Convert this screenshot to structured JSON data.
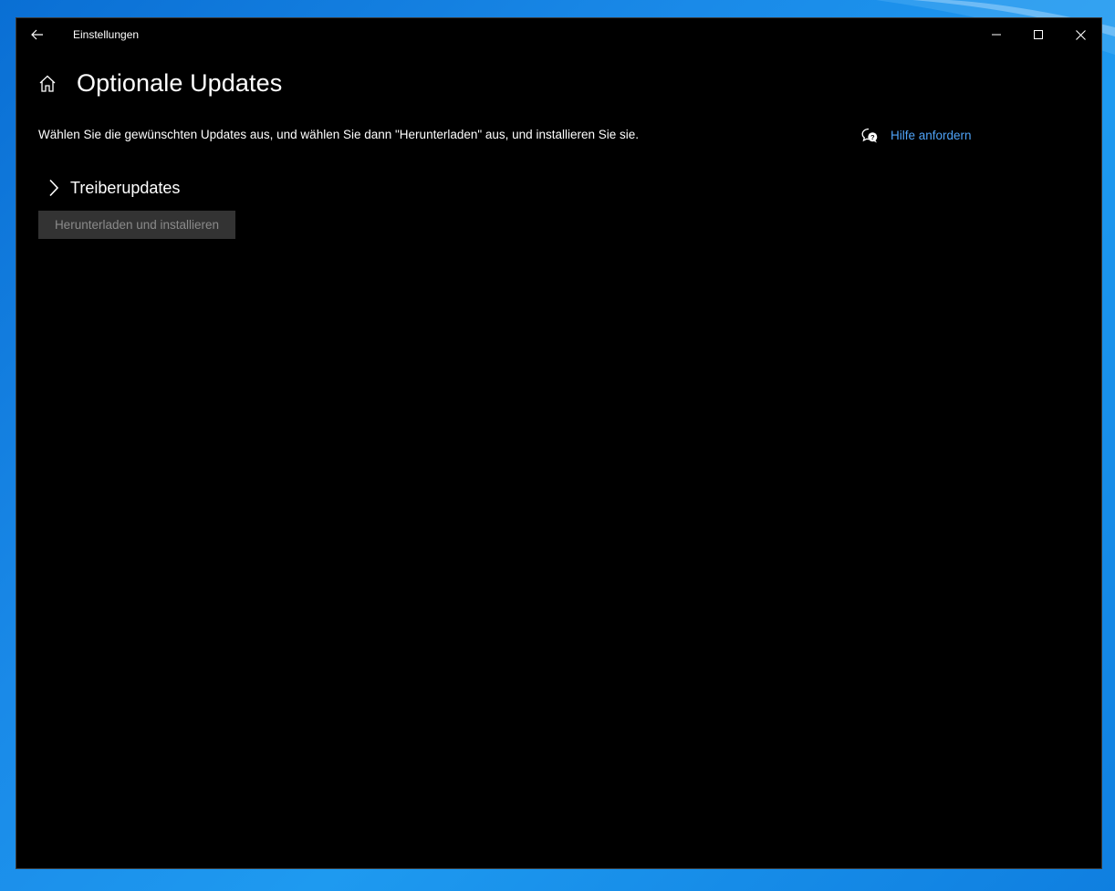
{
  "window": {
    "app_title": "Einstellungen",
    "back_icon": "arrow-left-icon",
    "controls": {
      "minimize_icon": "minimize-icon",
      "maximize_icon": "maximize-icon",
      "close_icon": "close-icon"
    }
  },
  "page": {
    "home_icon": "home-icon",
    "title": "Optionale Updates",
    "description": "Wählen Sie die gewünschten Updates aus, und wählen Sie dann \"Herunterladen\" aus, und installieren Sie sie.",
    "help": {
      "icon": "chat-help-icon",
      "label": "Hilfe anfordern"
    },
    "sections": [
      {
        "icon": "chevron-right-icon",
        "label": "Treiberupdates",
        "expanded": false
      }
    ],
    "action_button": {
      "label": "Herunterladen und installieren",
      "enabled": false
    }
  },
  "colors": {
    "window_background": "#000000",
    "accent_link": "#4fa3f7",
    "disabled_button_bg": "#333333",
    "disabled_button_text": "#8a8a8a",
    "desktop_background": "#1e90ea"
  }
}
